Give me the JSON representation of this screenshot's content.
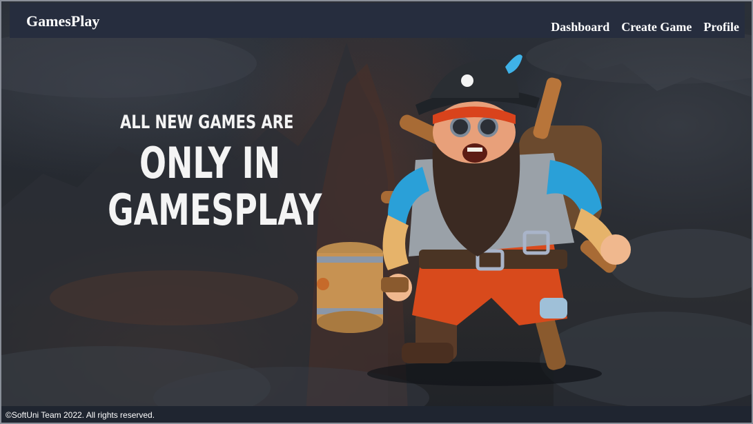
{
  "header": {
    "brand": "GamesPlay",
    "nav": {
      "dashboard": "Dashboard",
      "create_game": "Create Game",
      "profile": "Profile"
    }
  },
  "hero": {
    "line1": "ALL NEW GAMES ARE",
    "line2": "ONLY IN",
    "line3": "GAMESPLAY",
    "illustration": "pirate-dwarf-character"
  },
  "footer": {
    "text": "©SoftUni Team 2022. All rights reserved."
  },
  "colors": {
    "header_bg": "#262d3e",
    "footer_bg": "#1f2530",
    "text": "#ffffff"
  }
}
